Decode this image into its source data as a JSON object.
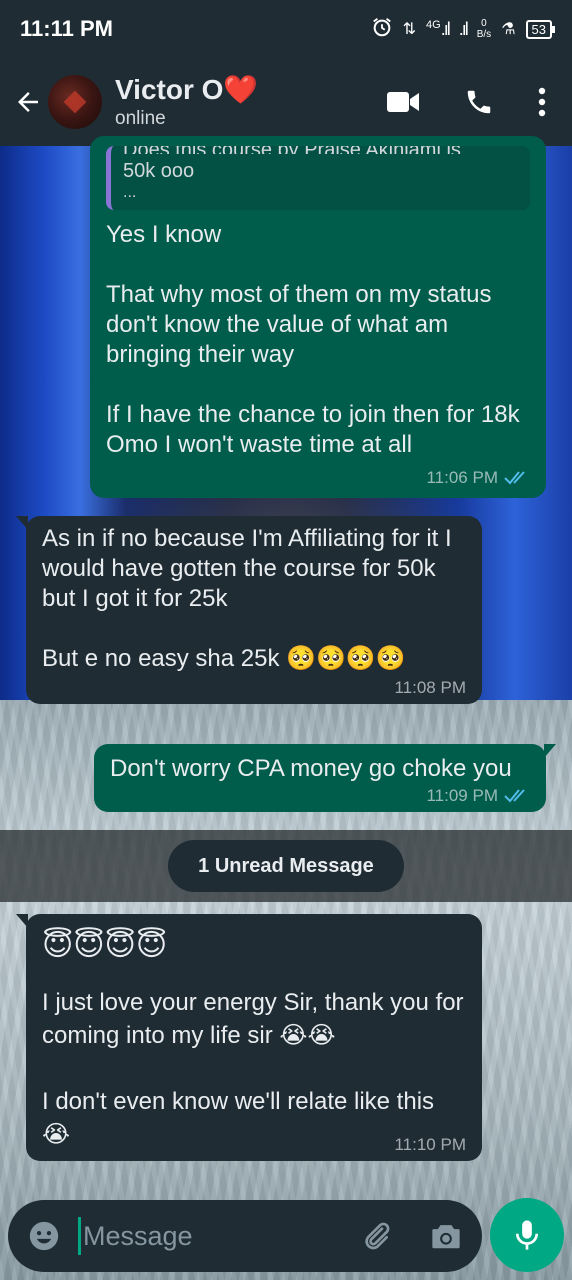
{
  "status_bar": {
    "time": "11:11 PM",
    "network": "4G",
    "speed_value": "0",
    "speed_unit": "B/s",
    "battery": "53"
  },
  "header": {
    "contact_name": "Victor O❤️",
    "contact_status": "online"
  },
  "messages": [
    {
      "direction": "outgoing",
      "quoted_clipped": "Does this course by Praise Akinlami is",
      "quoted_line": "50k ooo",
      "quoted_ellipsis": "...",
      "text": "Yes I know\n\nThat why most of them on my status don't know the value of what am bringing their way\n\nIf I have the chance to join then for 18k Omo I won't waste time at all",
      "time": "11:06 PM",
      "read": true
    },
    {
      "direction": "incoming",
      "text": "As in if no because I'm Affiliating for it I would have gotten the course for 50k but I got it for 25k\n\nBut e no easy sha 25k 🥺🥺🥺🥺",
      "time": "11:08 PM"
    },
    {
      "direction": "outgoing",
      "text": "Don't worry CPA money go choke you",
      "time": "11:09 PM",
      "read": true
    },
    {
      "direction": "incoming",
      "emoji_line": "😇😇😇😇",
      "text": "I just love your energy Sir, thank you for coming into my life sir 😭😭\n\nI don't even know we'll relate like this\n😭",
      "time": "11:10 PM"
    }
  ],
  "unread_banner": "1 Unread Message",
  "input": {
    "placeholder": "Message"
  },
  "colors": {
    "header_bg": "#1f2c34",
    "outgoing_bubble": "#005c4b",
    "incoming_bubble": "#1f2c34",
    "accent": "#00a884",
    "read_ticks": "#53bdeb"
  }
}
